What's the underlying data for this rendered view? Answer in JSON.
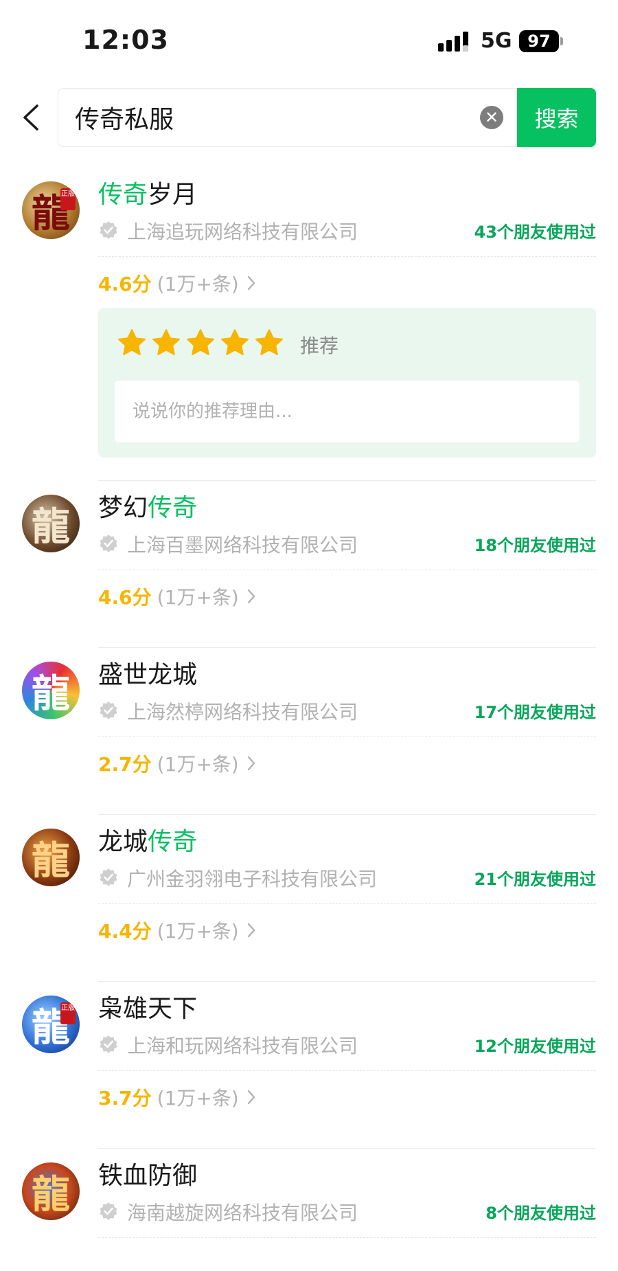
{
  "status_bar": {
    "time": "12:03",
    "network": "5G",
    "battery": "97",
    "signal_icon": "signal-bars-icon"
  },
  "search": {
    "value": "传奇私服",
    "button_label": "搜索",
    "clear_icon": "✕",
    "back_icon": "chevron-left-icon"
  },
  "colors": {
    "accent": "#07c160",
    "friends_text": "#07a65a",
    "rating": "#f7b500",
    "panel_bg": "#e9f7ef"
  },
  "results": [
    {
      "name_parts": [
        "",
        "传奇",
        "岁月"
      ],
      "icon": {
        "glyph": "龍",
        "badge": "正版",
        "name": "dragon-logo-icon"
      },
      "company": "上海追玩网络科技有限公司",
      "friends": "43个朋友使用过",
      "score": "4.6分",
      "reviews": "(1万+条)",
      "recommend": {
        "stars": 5,
        "label": "推荐",
        "placeholder": "说说你的推荐理由..."
      }
    },
    {
      "name_parts": [
        "梦幻",
        "传奇",
        ""
      ],
      "icon": {
        "glyph": "龍",
        "badge": "",
        "name": "dragon-logo-icon"
      },
      "company": "上海百墨网络科技有限公司",
      "friends": "18个朋友使用过",
      "score": "4.6分",
      "reviews": "(1万+条)"
    },
    {
      "name_parts": [
        "盛世龙城",
        "",
        ""
      ],
      "icon": {
        "glyph": "龍",
        "badge": "",
        "name": "dragon-logo-icon"
      },
      "company": "上海然楟网络科技有限公司",
      "friends": "17个朋友使用过",
      "score": "2.7分",
      "reviews": "(1万+条)"
    },
    {
      "name_parts": [
        "龙城",
        "传奇",
        ""
      ],
      "icon": {
        "glyph": "龍",
        "badge": "",
        "name": "dragon-logo-icon"
      },
      "company": "广州金羽翎电子科技有限公司",
      "friends": "21个朋友使用过",
      "score": "4.4分",
      "reviews": "(1万+条)"
    },
    {
      "name_parts": [
        "枭雄天下",
        "",
        ""
      ],
      "icon": {
        "glyph": "龍",
        "badge": "正版",
        "name": "dragon-logo-icon"
      },
      "company": "上海和玩网络科技有限公司",
      "friends": "12个朋友使用过",
      "score": "3.7分",
      "reviews": "(1万+条)"
    },
    {
      "name_parts": [
        "铁血防御",
        "",
        ""
      ],
      "icon": {
        "glyph": "龍",
        "badge": "",
        "name": "dragon-logo-icon"
      },
      "company": "海南越旋网络科技有限公司",
      "friends": "8个朋友使用过",
      "score": "",
      "reviews": ""
    }
  ]
}
